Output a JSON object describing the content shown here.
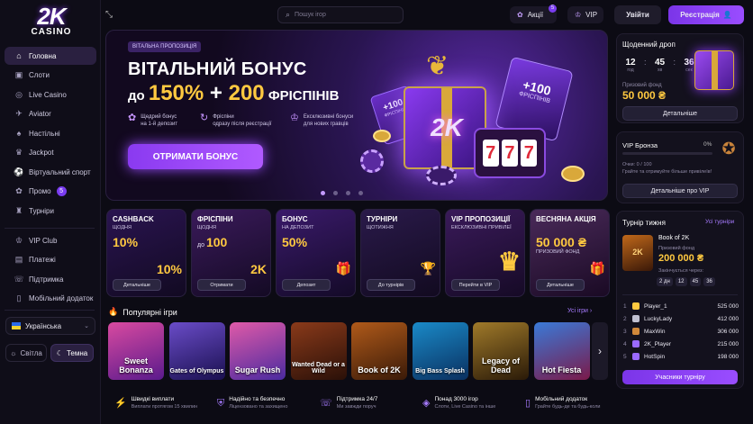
{
  "brand": {
    "logo_main": "2K",
    "logo_sub": "CASINO"
  },
  "sidebar": {
    "items": [
      {
        "icon": "home-icon",
        "glyph": "⌂",
        "label": "Головна",
        "active": true
      },
      {
        "icon": "slots-icon",
        "glyph": "▣",
        "label": "Слоти"
      },
      {
        "icon": "live-casino-icon",
        "glyph": "◎",
        "label": "Live Casino"
      },
      {
        "icon": "aviator-icon",
        "glyph": "✈",
        "label": "Aviator"
      },
      {
        "icon": "table-games-icon",
        "glyph": "♠",
        "label": "Настільні"
      },
      {
        "icon": "jackpot-icon",
        "glyph": "♛",
        "label": "Jackpot"
      },
      {
        "icon": "virtual-sport-icon",
        "glyph": "⚽",
        "label": "Віртуальний спорт"
      },
      {
        "icon": "promo-gift-icon",
        "glyph": "✿",
        "label": "Промо",
        "badge": "5"
      },
      {
        "icon": "trophy-icon",
        "glyph": "♜",
        "label": "Турніри"
      }
    ],
    "items2": [
      {
        "icon": "crown-icon",
        "glyph": "♔",
        "label": "VIP Club"
      },
      {
        "icon": "wallet-icon",
        "glyph": "▤",
        "label": "Платежі"
      },
      {
        "icon": "headset-icon",
        "glyph": "☏",
        "label": "Підтримка"
      },
      {
        "icon": "mobile-icon",
        "glyph": "▯",
        "label": "Мобільний додаток"
      }
    ],
    "language": "Українська",
    "theme_light": "Світла",
    "theme_dark": "Темна"
  },
  "topbar": {
    "search_placeholder": "Пошук ігор",
    "promos_label": "Акції",
    "promos_badge": "5",
    "vip_label": "VIP",
    "login": "Увійти",
    "register": "Реєстрація"
  },
  "hero": {
    "tag": "ВІТАЛЬНА ПРОПОЗИЦІЯ",
    "title1": "ВІТАЛЬНИЙ БОНУС",
    "t2_pre": "до ",
    "t2_pct": "150%",
    "t2_plus": " + ",
    "t2_num": "200",
    "t2_word": " ФРІСПІНІВ",
    "features": [
      {
        "l1": "Щедрий бонус",
        "l2": "на 1-й депозит"
      },
      {
        "l1": "Фріспіни",
        "l2": "одразу після реєстрації"
      },
      {
        "l1": "Ексклюзивні бонуси",
        "l2": "для нових гравців"
      }
    ],
    "cta": "ОТРИМАТИ БОНУС",
    "ticket1_pre": "+100",
    "ticket1_sub": "ФРІСПІНІВ",
    "ticket2_pre": "+100",
    "ticket2_sub": "ФРІСПІНІВ",
    "box_logo": "2K",
    "slots": [
      "7",
      "7",
      "7"
    ],
    "slides_active": 1
  },
  "daily_drop": {
    "title": "Щоденний дроп",
    "h": "12",
    "m": "45",
    "s": "36",
    "h_lab": "год",
    "m_lab": "хв",
    "s_lab": "сек",
    "prize_label": "Призовий фонд",
    "prize": "50 000 ₴",
    "button": "Детальніше"
  },
  "vip": {
    "title": "VIP Бронза",
    "pct": "0%",
    "points": "Очки: 0 / 100",
    "hint": "Грайте та отримуйте більше привілеїв!",
    "button": "Детальніше про VIP",
    "progress": 0
  },
  "promos": [
    {
      "title": "CASHBACK",
      "sub": "ЩОДНЯ",
      "value": "10%",
      "small": "",
      "button": "Детальніше",
      "art": "10%"
    },
    {
      "title": "ФРІСПІНИ",
      "sub": "ЩОДНЯ",
      "value": "100",
      "small": "до ",
      "button": "Отримати",
      "art": "2K"
    },
    {
      "title": "БОНУС",
      "sub": "НА ДЕПОЗИТ",
      "value": "50%",
      "small": "",
      "button": "Депозит",
      "art": "🎁"
    },
    {
      "title": "ТУРНІРИ",
      "sub": "ЩОТИЖНЯ",
      "value": "",
      "small": "",
      "button": "До турнірів",
      "art": "🏆"
    },
    {
      "title": "VIP ПРОПОЗИЦІЇ",
      "sub": "ЕКСКЛЮЗИВНІ ПРИВІЛЕЇ",
      "value": "",
      "small": "",
      "button": "Перейти в VIP",
      "art": "♛"
    },
    {
      "title": "ВЕСНЯНА АКЦІЯ",
      "sub": "",
      "value": "50 000 ₴",
      "small": "",
      "sub2": "ПРИЗОВИЙ ФОНД",
      "button": "Детальніше",
      "art": "🎁"
    }
  ],
  "games_section": {
    "title": "Популярні ігри",
    "all": "Усі ігри"
  },
  "games": [
    {
      "name": "Sweet Bonanza",
      "bg": "#d94aa0",
      "bg2": "#5a1a8c"
    },
    {
      "name": "Gates of Olympus",
      "bg": "#6a4cc8",
      "bg2": "#1a1050"
    },
    {
      "name": "Sugar Rush",
      "bg": "#e05aa8",
      "bg2": "#4a2aa0"
    },
    {
      "name": "Wanted Dead or a Wild",
      "bg": "#8a3a1a",
      "bg2": "#2a1008"
    },
    {
      "name": "Book of 2K",
      "bg": "#b05a1a",
      "bg2": "#3a1a08"
    },
    {
      "name": "Big Bass Splash",
      "bg": "#1a8ac8",
      "bg2": "#0a3060"
    },
    {
      "name": "Legacy of Dead",
      "bg": "#a07a2a",
      "bg2": "#2a1a08"
    },
    {
      "name": "Hot Fiesta",
      "bg": "#3a7ad8",
      "bg2": "#7a1a4a"
    }
  ],
  "games_next_icon": "›",
  "tournament": {
    "title": "Турнір тижня",
    "all": "Усі турніри",
    "game": "Book of 2K",
    "prize_label": "Призовий фонд",
    "prize": "200 000 ₴",
    "ends_label": "Закінчується через:",
    "d": "2 дн",
    "h": "12",
    "m": "45",
    "s": "36",
    "leaders": [
      {
        "rank": "1",
        "name": "Player_1",
        "score": "525 000"
      },
      {
        "rank": "2",
        "name": "LuckyLady",
        "score": "412 000"
      },
      {
        "rank": "3",
        "name": "MaxWin",
        "score": "306 000"
      },
      {
        "rank": "4",
        "name": "2K_Player",
        "score": "215 000"
      },
      {
        "rank": "5",
        "name": "HotSpin",
        "score": "198 000"
      }
    ],
    "button": "Учасники турніру"
  },
  "footer": [
    {
      "icon": "lightning-icon",
      "glyph": "⚡",
      "t": "Швидкі виплати",
      "s": "Виплати протягом 15 хвилин"
    },
    {
      "icon": "shield-icon",
      "glyph": "⛨",
      "t": "Надійно та безпечно",
      "s": "Ліцензовано та захищено"
    },
    {
      "icon": "support-icon",
      "glyph": "☏",
      "t": "Підтримка 24/7",
      "s": "Ми завжди поруч"
    },
    {
      "icon": "gamepad-icon",
      "glyph": "◈",
      "t": "Понад 3000 ігор",
      "s": "Слоти, Live Casino та інше"
    },
    {
      "icon": "phone-icon",
      "glyph": "▯",
      "t": "Мобільний додаток",
      "s": "Грайте будь-де та будь-коли"
    }
  ],
  "colors": {
    "accent": "#8a3af0",
    "gold": "#ffc940",
    "bg": "#0c0b14"
  }
}
